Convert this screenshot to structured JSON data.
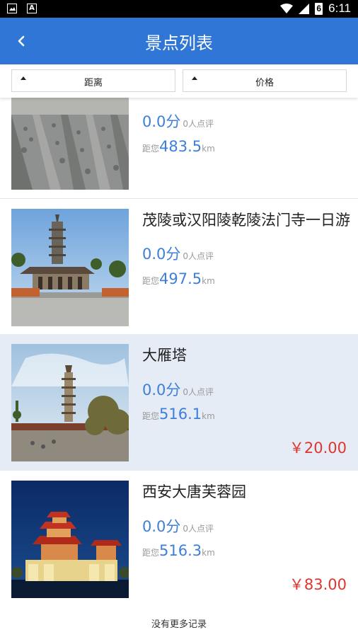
{
  "status_bar": {
    "time": "6:11",
    "battery_level": "6"
  },
  "header": {
    "title": "景点列表"
  },
  "filters": {
    "distance": "距离",
    "price": "价格"
  },
  "items": [
    {
      "name": "",
      "score": "0.0分",
      "reviews": "0人点评",
      "dist_prefix": "距您",
      "distance": "483.5",
      "unit": "km",
      "price": "",
      "image": "terracotta-army"
    },
    {
      "name": "茂陵或汉阳陵乾陵法门寺一日游",
      "score": "0.0分",
      "reviews": "0人点评",
      "dist_prefix": "距您",
      "distance": "497.5",
      "unit": "km",
      "price": "",
      "image": "famen-temple-pagoda"
    },
    {
      "name": "大雁塔",
      "score": "0.0分",
      "reviews": "0人点评",
      "dist_prefix": "距您",
      "distance": "516.1",
      "unit": "km",
      "price": "￥20.00",
      "image": "big-wild-goose-pagoda",
      "highlighted": true
    },
    {
      "name": "西安大唐芙蓉园",
      "score": "0.0分",
      "reviews": "0人点评",
      "dist_prefix": "距您",
      "distance": "516.3",
      "unit": "km",
      "price": "￥83.00",
      "image": "tang-paradise-night"
    }
  ],
  "footer": {
    "text": "没有更多记录"
  },
  "colors": {
    "appbar": "#2f76d6",
    "accent": "#3d7fd9",
    "price": "#e0342f",
    "highlight_row": "#e5ecf5"
  }
}
